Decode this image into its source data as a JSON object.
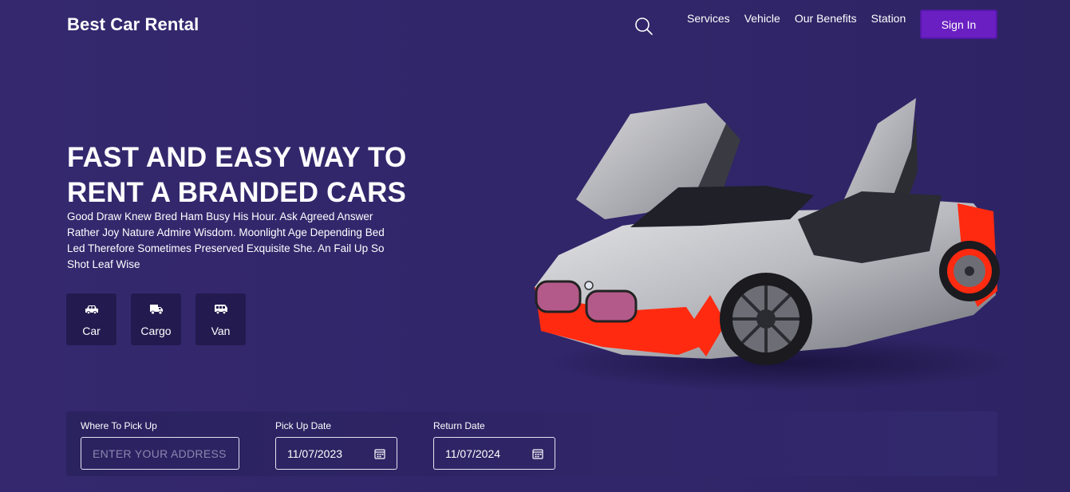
{
  "header": {
    "brand": "Best Car Rental",
    "search_icon": "search-icon",
    "nav": [
      "Services",
      "Vehicle",
      "Our Benefits",
      "Station"
    ],
    "signin_label": "Sign In"
  },
  "hero": {
    "title_line1": "FAST AND EASY WAY TO",
    "title_line2": "RENT A BRANDED CARS",
    "description": "Good Draw Knew Bred Ham Busy His Hour. Ask Agreed Answer Rather Joy Nature Admire Wisdom. Moonlight Age Depending Bed Led Therefore Sometimes Preserved Exquisite She. An Fail Up So Shot Leaf Wise",
    "vehicle_types": [
      {
        "label": "Car",
        "icon": "car-icon"
      },
      {
        "label": "Cargo",
        "icon": "truck-icon"
      },
      {
        "label": "Van",
        "icon": "van-icon"
      }
    ]
  },
  "booking": {
    "pickup_label": "Where To Pick Up",
    "pickup_placeholder": "ENTER YOUR ADDRESS",
    "pickup_date_label": "Pick Up Date",
    "pickup_date_value": "11/07/2023",
    "return_date_label": "Return Date",
    "return_date_value": "11/07/2024"
  },
  "colors": {
    "background": "#33286c",
    "accent": "#6a1fc2",
    "card": "#231b4f",
    "car_accent": "#ff2a10"
  }
}
